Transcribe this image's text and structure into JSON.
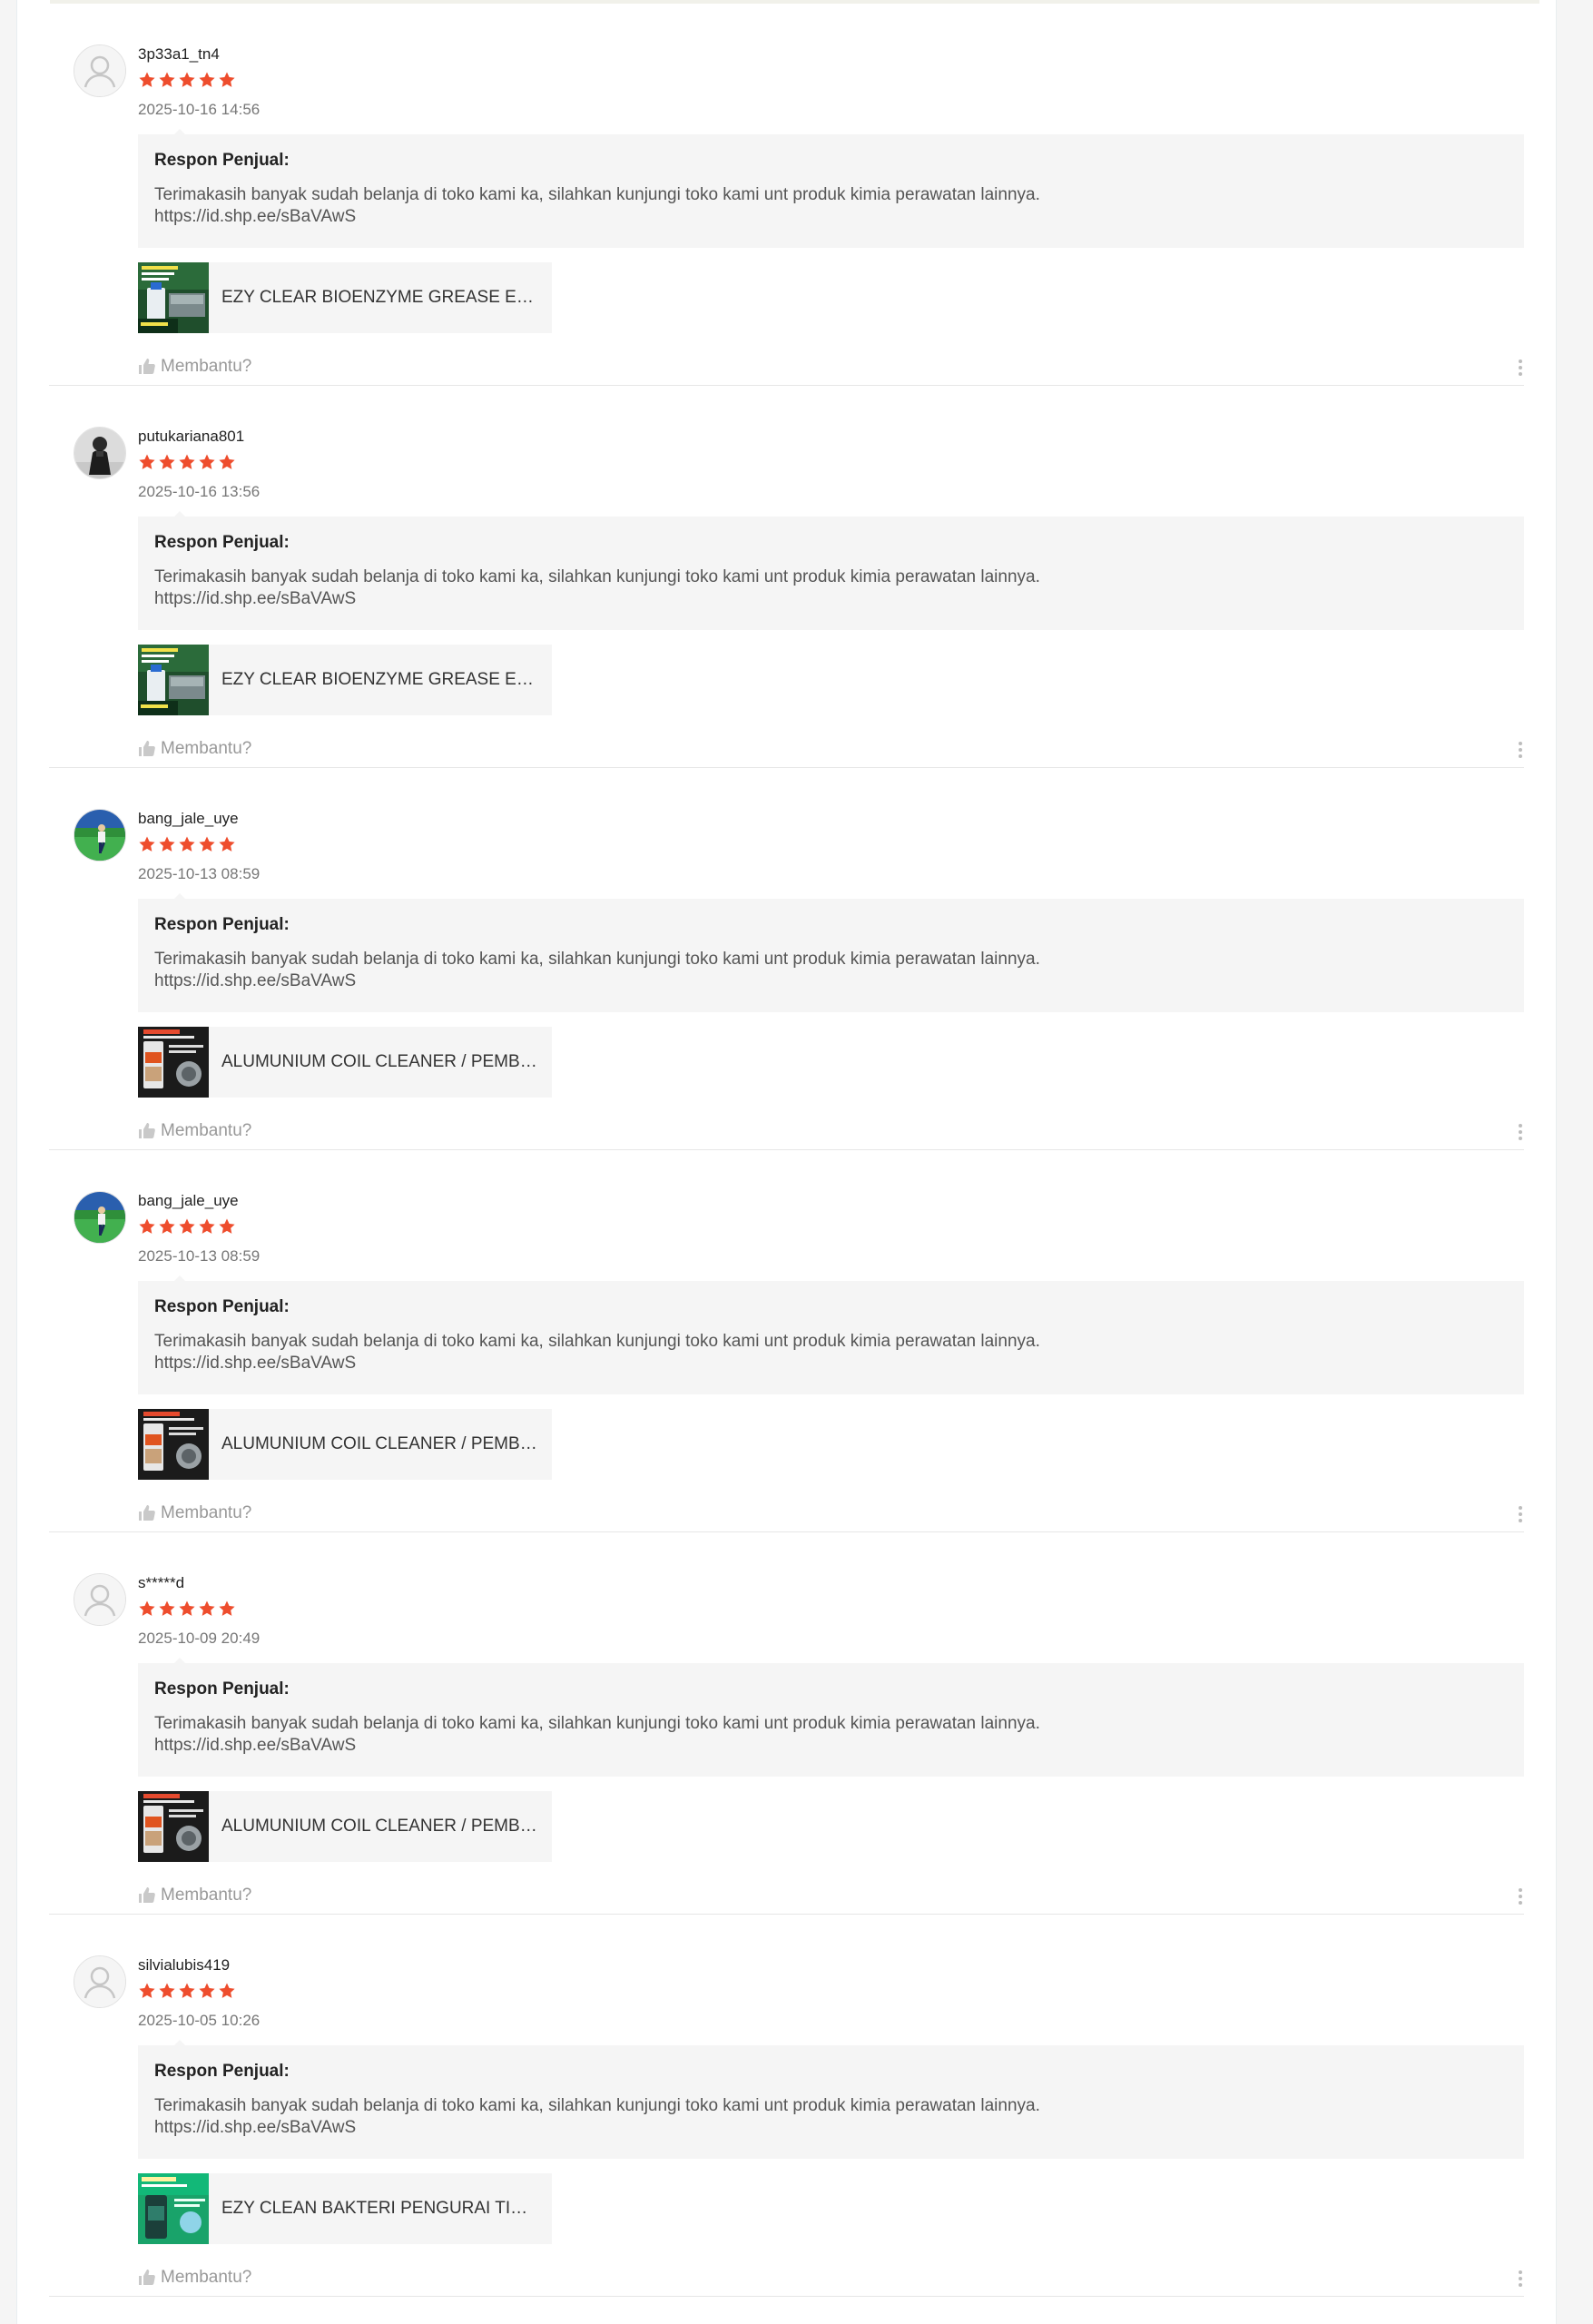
{
  "reviews": [
    {
      "username": "3p33a1_tn4",
      "avatar_icon": "default-user-avatar",
      "rating": 5,
      "date": "2025-10-16 14:56",
      "reply_title": "Respon Penjual:",
      "reply_text": "Terimakasih banyak sudah belanja di toko kami ka, silahkan kunjungi toko kami unt produk kimia perawatan lainnya.\n https://id.shp.ee/sBaVAwS",
      "product_name": "EZY CLEAR BIOENZYME GREASE EATER",
      "product_thumb": "grease-eater-thumb",
      "helpful_label": "Membantu?"
    },
    {
      "username": "putukariana801",
      "avatar_icon": "person-photo-avatar",
      "rating": 5,
      "date": "2025-10-16 13:56",
      "reply_title": "Respon Penjual:",
      "reply_text": "Terimakasih banyak sudah belanja di toko kami ka, silahkan kunjungi toko kami unt produk kimia perawatan lainnya.\n https://id.shp.ee/sBaVAwS",
      "product_name": "EZY CLEAR BIOENZYME GREASE EATER",
      "product_thumb": "grease-eater-thumb",
      "helpful_label": "Membantu?"
    },
    {
      "username": "bang_jale_uye",
      "avatar_icon": "football-photo-avatar",
      "rating": 5,
      "date": "2025-10-13 08:59",
      "reply_title": "Respon Penjual:",
      "reply_text": "Terimakasih banyak sudah belanja di toko kami ka, silahkan kunjungi toko kami unt produk kimia perawatan lainnya.\n https://id.shp.ee/sBaVAwS",
      "product_name": "ALUMUNIUM COIL CLEANER / PEMBERSIH",
      "product_thumb": "coil-cleaner-thumb",
      "helpful_label": "Membantu?"
    },
    {
      "username": "bang_jale_uye",
      "avatar_icon": "football-photo-avatar",
      "rating": 5,
      "date": "2025-10-13 08:59",
      "reply_title": "Respon Penjual:",
      "reply_text": "Terimakasih banyak sudah belanja di toko kami ka, silahkan kunjungi toko kami unt produk kimia perawatan lainnya.\n https://id.shp.ee/sBaVAwS",
      "product_name": "ALUMUNIUM COIL CLEANER / PEMBERSIH",
      "product_thumb": "coil-cleaner-thumb",
      "helpful_label": "Membantu?"
    },
    {
      "username": "s*****d",
      "avatar_icon": "default-user-avatar",
      "rating": 5,
      "date": "2025-10-09 20:49",
      "reply_title": "Respon Penjual:",
      "reply_text": "Terimakasih banyak sudah belanja di toko kami ka, silahkan kunjungi toko kami unt produk kimia perawatan lainnya.\n https://id.shp.ee/sBaVAwS",
      "product_name": "ALUMUNIUM COIL CLEANER / PEMBERSIH",
      "product_thumb": "coil-cleaner-thumb",
      "helpful_label": "Membantu?"
    },
    {
      "username": "silvialubis419",
      "avatar_icon": "default-user-avatar",
      "rating": 5,
      "date": "2025-10-05 10:26",
      "reply_title": "Respon Penjual:",
      "reply_text": "Terimakasih banyak sudah belanja di toko kami ka, silahkan kunjungi toko kami unt produk kimia perawatan lainnya.\n https://id.shp.ee/sBaVAwS",
      "product_name": "EZY CLEAN BAKTERI PENGURAI TINJA",
      "product_thumb": "bakteri-thumb",
      "helpful_label": "Membantu?"
    }
  ],
  "colors": {
    "star": "#ee4d2d",
    "reply_bg": "#f5f5f5",
    "muted_text": "#999999"
  }
}
